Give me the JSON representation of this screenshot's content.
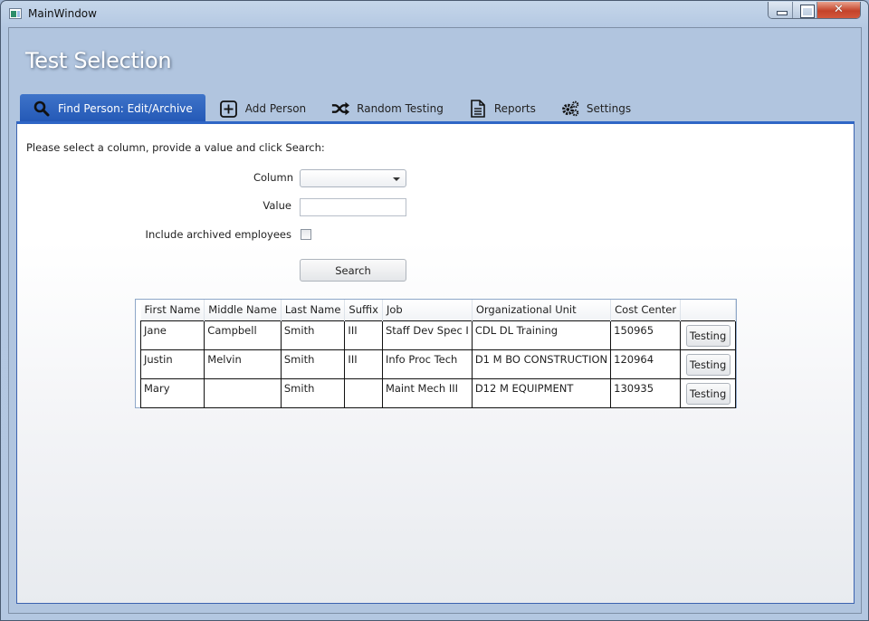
{
  "window": {
    "title": "MainWindow",
    "controls": {
      "minimize": "minimize",
      "maximize": "maximize",
      "close": "✕"
    }
  },
  "app": {
    "title": "Test Selection"
  },
  "tabs": [
    {
      "label": "Find Person: Edit/Archive",
      "icon": "search-icon",
      "active": true
    },
    {
      "label": "Add Person",
      "icon": "plus-box-icon",
      "active": false
    },
    {
      "label": "Random Testing",
      "icon": "shuffle-icon",
      "active": false
    },
    {
      "label": "Reports",
      "icon": "document-icon",
      "active": false
    },
    {
      "label": "Settings",
      "icon": "gears-icon",
      "active": false
    }
  ],
  "form": {
    "instructions": "Please select a column, provide a value and click Search:",
    "column_label": "Column",
    "column_value": "",
    "value_label": "Value",
    "value_value": "",
    "archived_label": "Include archived employees",
    "archived_checked": false,
    "search_label": "Search"
  },
  "grid": {
    "columns": [
      "First Name",
      "Middle Name",
      "Last Name",
      "Suffix",
      "Job",
      "Organizational Unit",
      "Cost Center",
      ""
    ],
    "rows": [
      {
        "first": "Jane",
        "middle": "Campbell",
        "last": "Smith",
        "suffix": "III",
        "job": "Staff Dev Spec I",
        "org": "CDL DL Training",
        "cost": "150965",
        "action": "Testing"
      },
      {
        "first": "Justin",
        "middle": "Melvin",
        "last": "Smith",
        "suffix": "III",
        "job": "Info Proc Tech",
        "org": "D1 M BO CONSTRUCTION",
        "cost": "120964",
        "action": "Testing"
      },
      {
        "first": "Mary",
        "middle": "",
        "last": "Smith",
        "suffix": "",
        "job": "Maint Mech III",
        "org": "D12 M EQUIPMENT",
        "cost": "130935",
        "action": "Testing"
      }
    ]
  }
}
